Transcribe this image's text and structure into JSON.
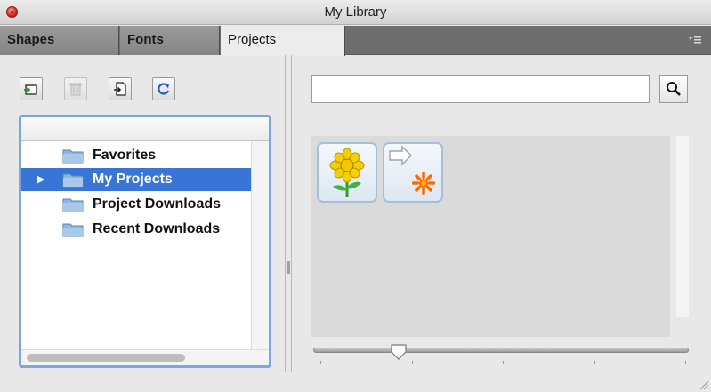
{
  "window": {
    "title": "My Library"
  },
  "tabs": [
    {
      "label": "Shapes",
      "active": false
    },
    {
      "label": "Fonts",
      "active": false
    },
    {
      "label": "Projects",
      "active": true
    }
  ],
  "toolbar": {
    "buttons": [
      {
        "icon": "add-folder-icon",
        "enabled": true
      },
      {
        "icon": "trash-icon",
        "enabled": false
      },
      {
        "icon": "import-icon",
        "enabled": true
      },
      {
        "icon": "refresh-icon",
        "enabled": true
      }
    ]
  },
  "tree": {
    "items": [
      {
        "label": "Favorites",
        "selected": false,
        "expandable": false
      },
      {
        "label": "My Projects",
        "selected": true,
        "expandable": true
      },
      {
        "label": "Project Downloads",
        "selected": false,
        "expandable": false
      },
      {
        "label": "Recent Downloads",
        "selected": false,
        "expandable": false
      }
    ]
  },
  "search": {
    "value": "",
    "placeholder": "",
    "button_icon": "magnifier-icon"
  },
  "gallery": {
    "items": [
      {
        "icon": "sunflower-icon"
      },
      {
        "icon": "shortcut-star-icon"
      }
    ]
  },
  "zoom_slider": {
    "value": 0.21,
    "tick_count": 5
  },
  "colors": {
    "selection": "#3875d7",
    "focus_ring": "#7aa7e0",
    "tab_strip": "#6e6e6e"
  }
}
